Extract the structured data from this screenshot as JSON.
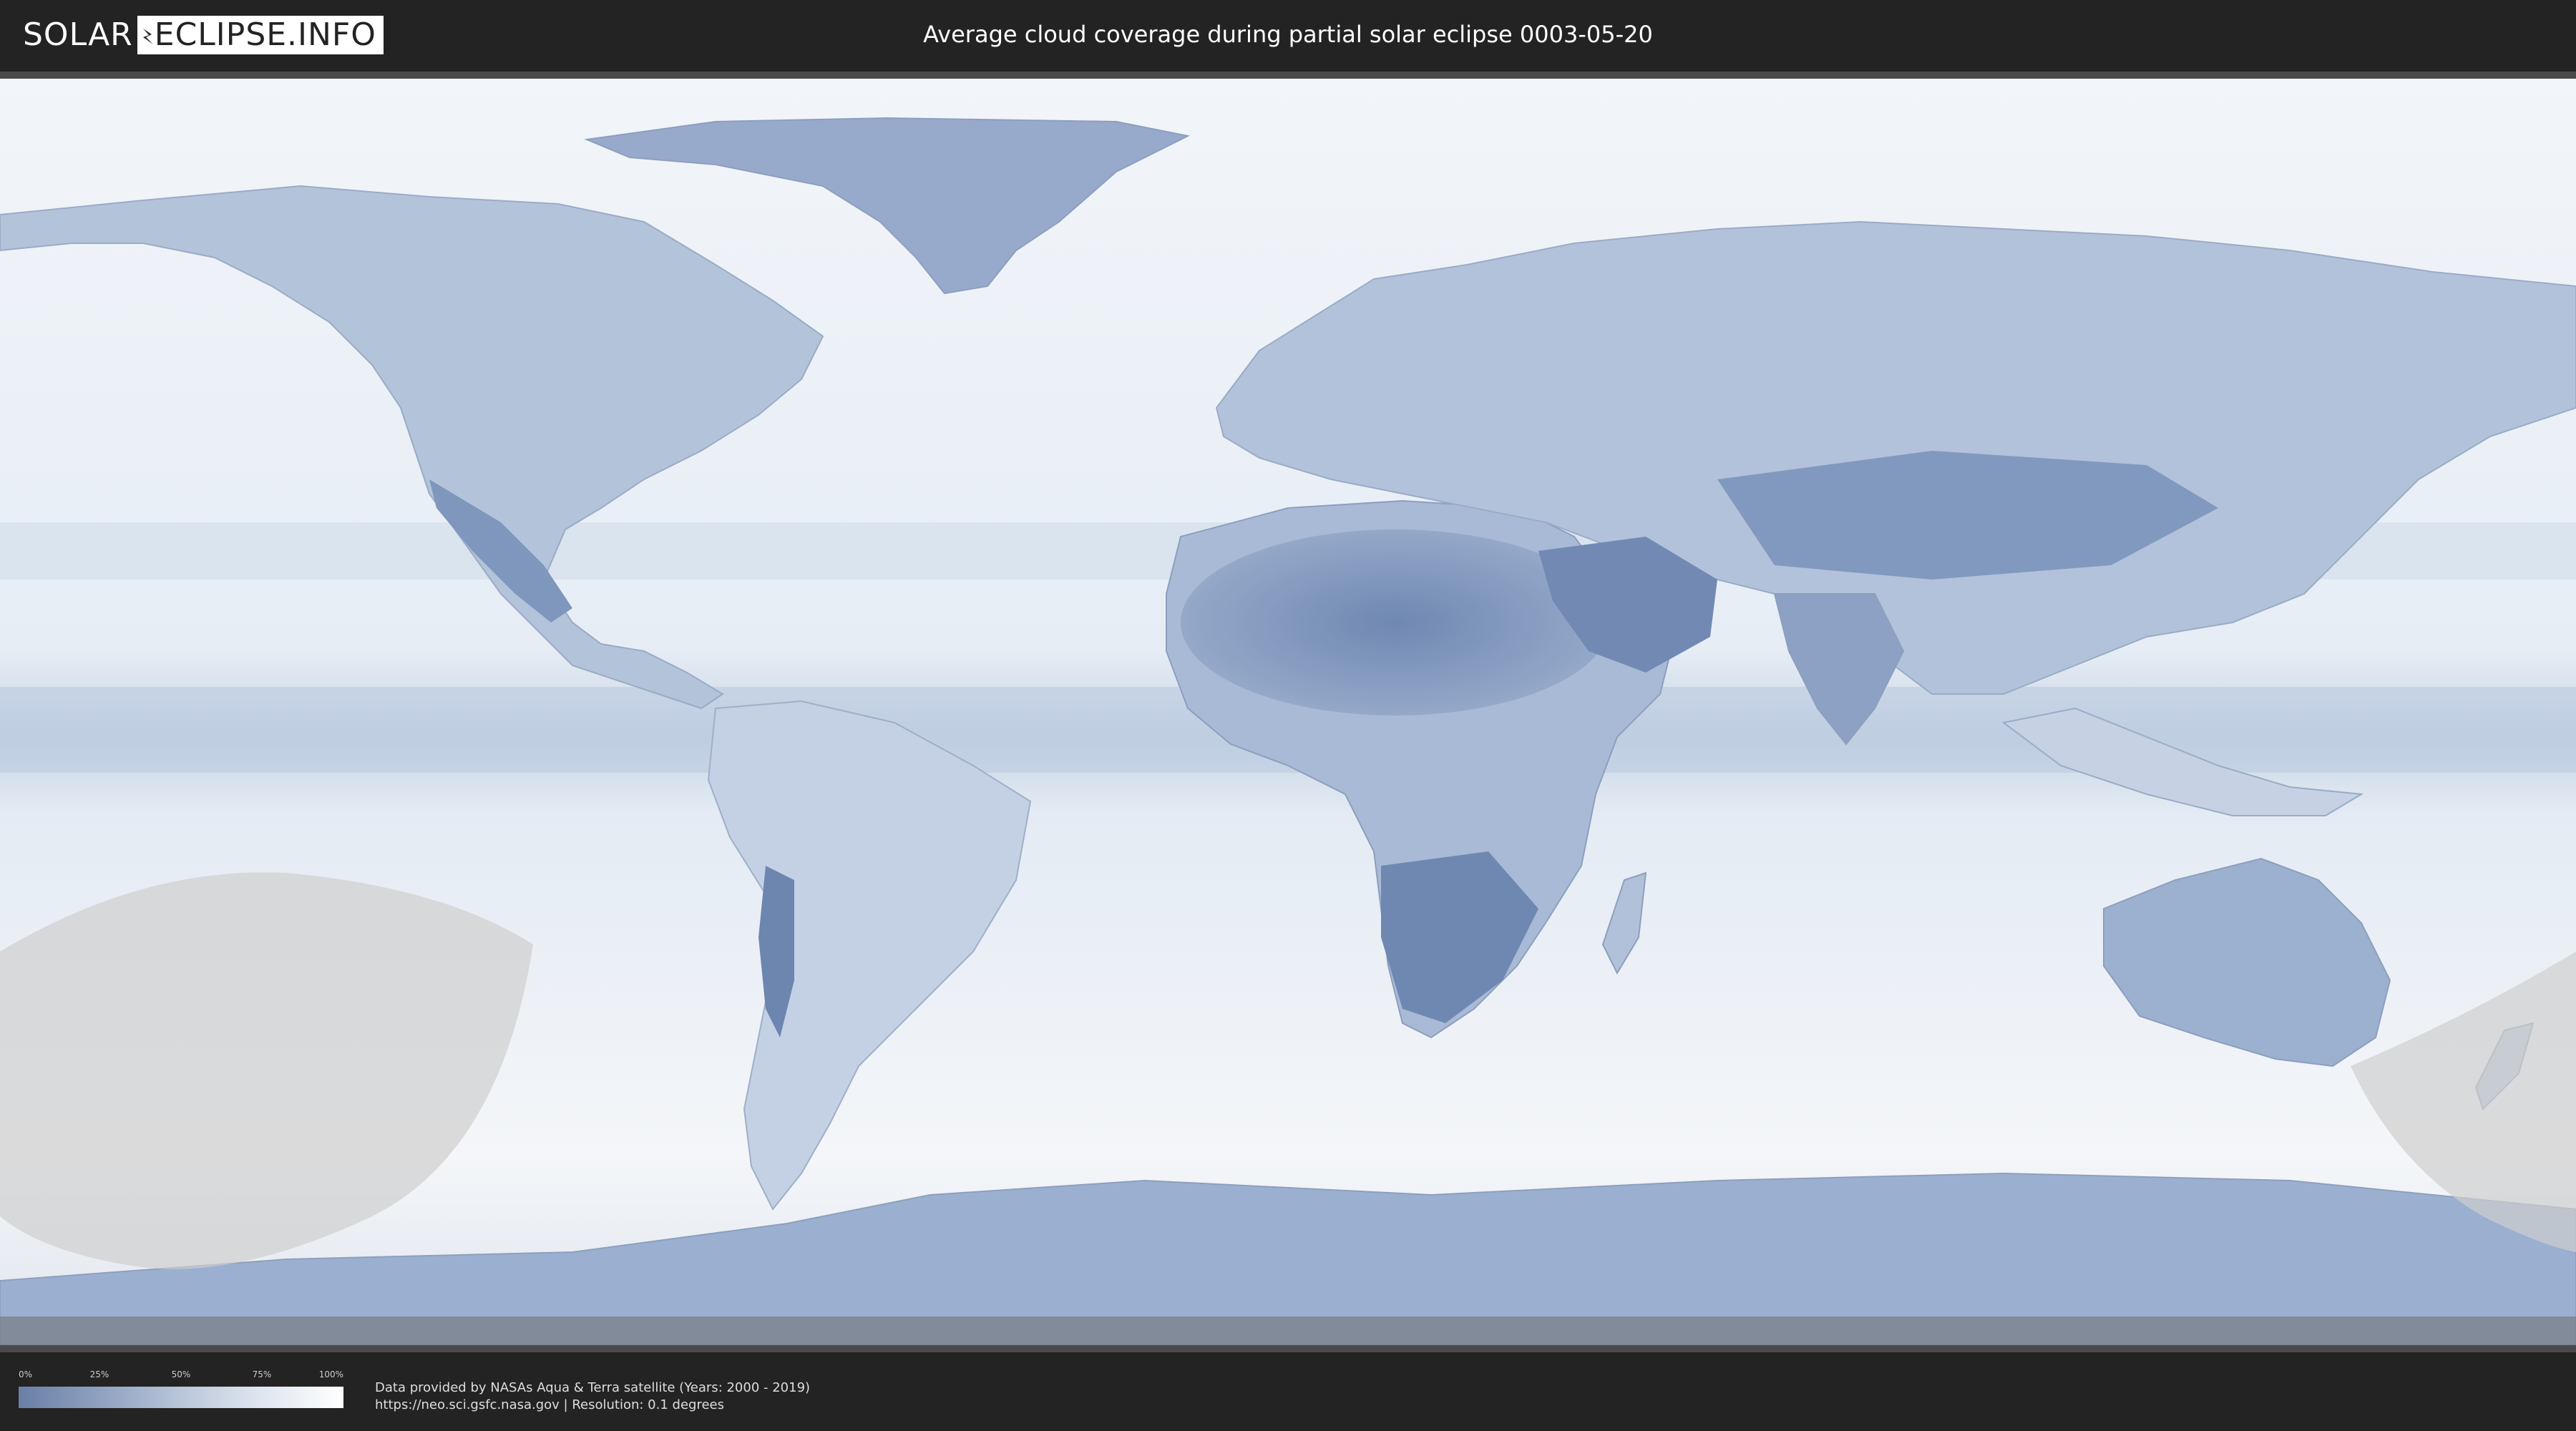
{
  "header": {
    "logo_left": "SOLAR",
    "logo_right": "ECLIPSE.INFO",
    "title": "Average cloud coverage during partial solar eclipse 0003-05-20"
  },
  "map": {
    "icon": "world-map",
    "ocean_color": "#e9eff6",
    "land_color": "#aebfd7",
    "dense_land_color": "#7f97bd",
    "eclipse_shadow_color": "#cfcfcf",
    "ice_color": "#c2cfe2"
  },
  "legend": {
    "ticks": [
      "0%",
      "25%",
      "50%",
      "75%",
      "100%"
    ],
    "gradient_start": "#6a7fa6",
    "gradient_end": "#ffffff"
  },
  "credits": {
    "line1": "Data provided by NASAs Aqua & Terra satellite (Years: 2000 - 2019)",
    "line2": "https://neo.sci.gsfc.nasa.gov | Resolution: 0.1 degrees"
  }
}
